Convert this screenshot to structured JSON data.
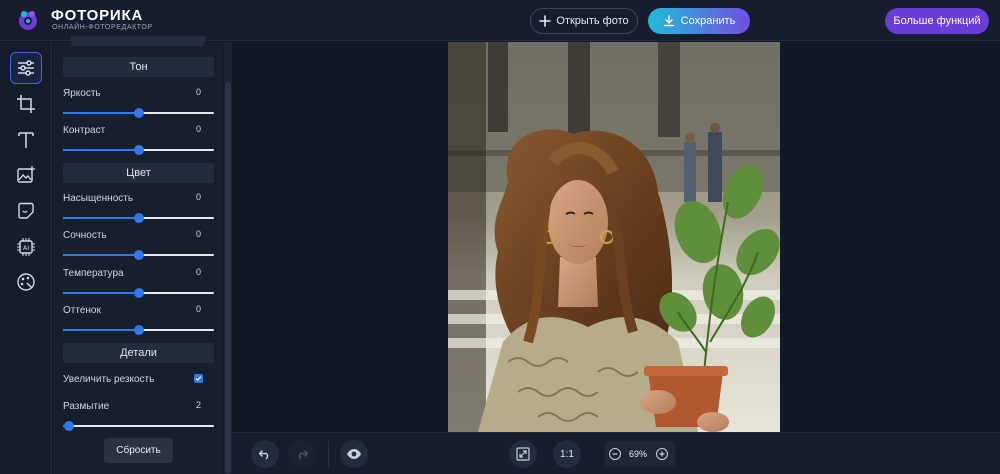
{
  "brand": {
    "name": "ФОТОРИКА",
    "tagline": "ОНЛАЙН-ФОТОРЕДАКТОР",
    "accent": "#6a3ed6"
  },
  "header": {
    "open_label": "Открыть фото",
    "save_label": "Сохранить",
    "more_label": "Больше функций"
  },
  "rail": {
    "tools": [
      "adjust-icon",
      "crop-icon",
      "text-icon",
      "image-add-icon",
      "sticker-icon",
      "ai-chip-icon",
      "palette-icon"
    ],
    "active": "adjust-icon"
  },
  "panel": {
    "tone": {
      "title": "Тон",
      "brightness": {
        "label": "Яркость",
        "value": "0",
        "level": 0.5
      },
      "contrast": {
        "label": "Контраст",
        "value": "0",
        "level": 0.5
      }
    },
    "color": {
      "title": "Цвет",
      "saturation": {
        "label": "Насыщенность",
        "value": "0",
        "level": 0.5
      },
      "vibrance": {
        "label": "Сочность",
        "value": "0",
        "level": 0.5
      },
      "temperature": {
        "label": "Температура",
        "value": "0",
        "level": 0.5
      },
      "tint": {
        "label": "Оттенок",
        "value": "0",
        "level": 0.5
      }
    },
    "details": {
      "title": "Детали",
      "sharpen": {
        "label": "Увеличить резкость",
        "checked": true
      },
      "blur": {
        "label": "Размытие",
        "value": "2",
        "level": 0.04
      }
    },
    "reset_label": "Сбросить"
  },
  "bottom": {
    "ratio_label": "1:1",
    "zoom": "69%"
  },
  "colors": {
    "slider_fill": "#2f7af0",
    "save_gradient_start": "#22bcd9",
    "save_gradient_end": "#6f4fe0"
  }
}
